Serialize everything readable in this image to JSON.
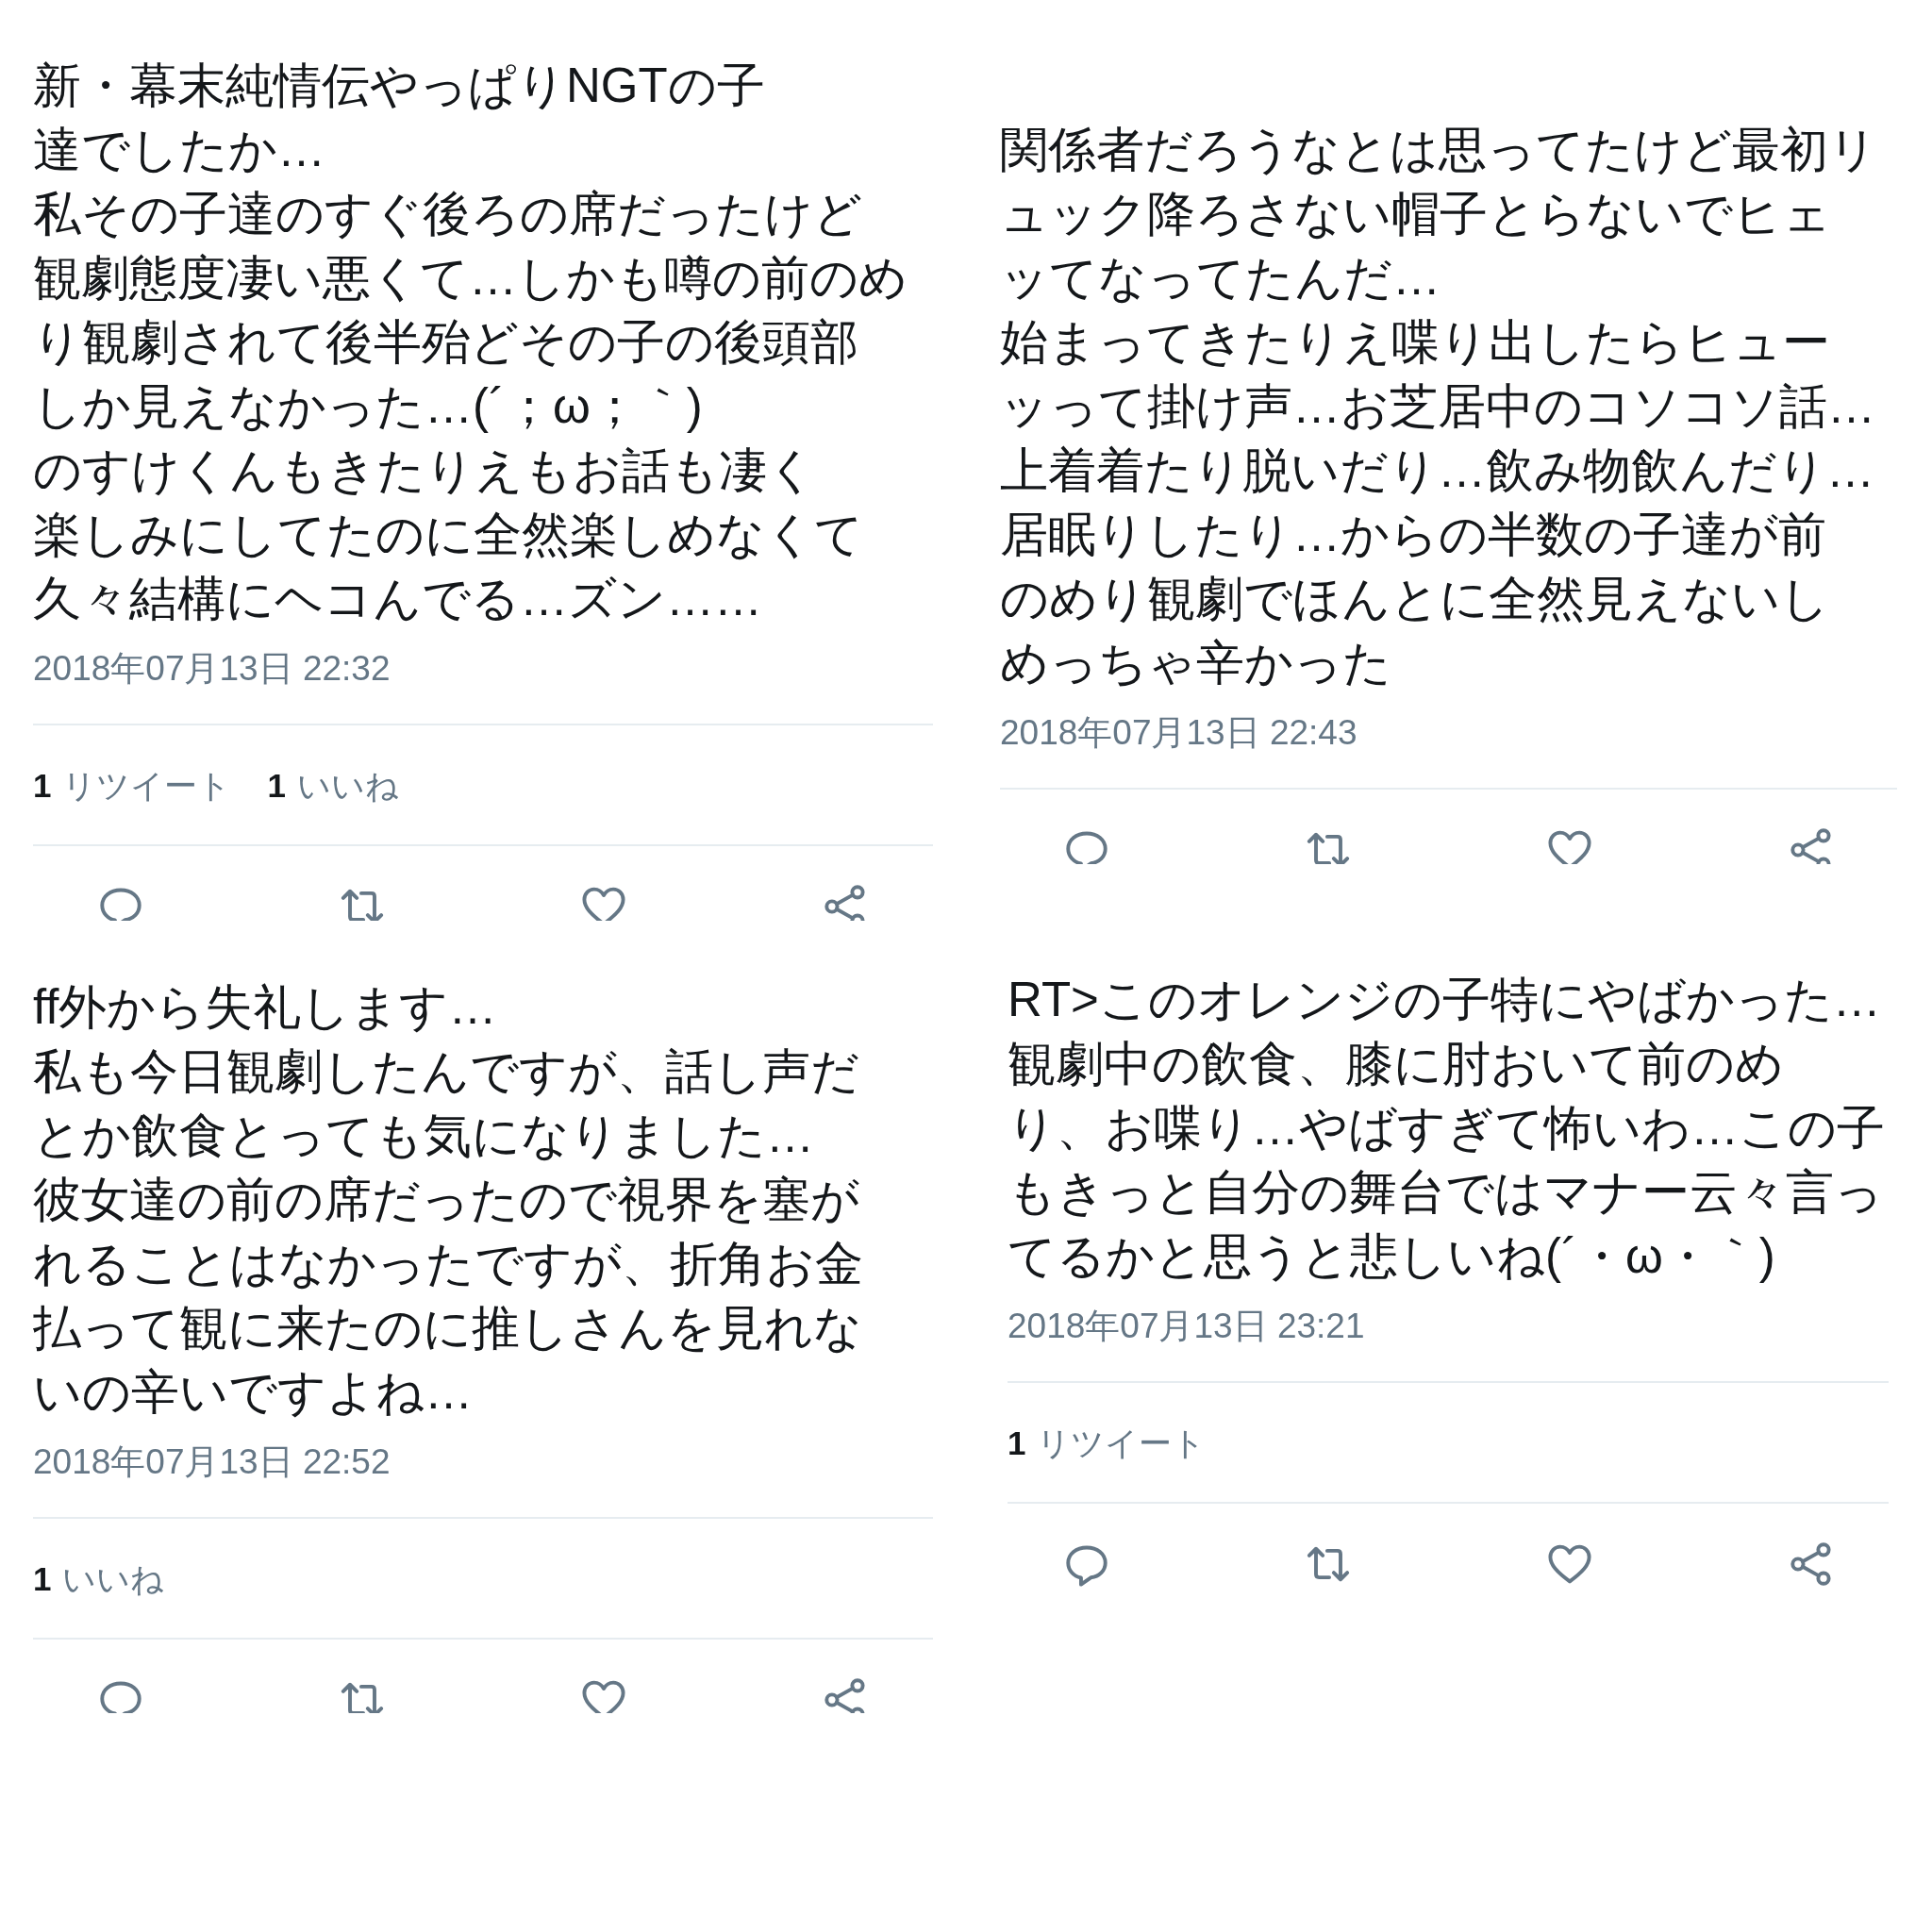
{
  "columns": [
    {
      "tweets": [
        {
          "text_lines": [
            "新・幕末純情伝やっぱりNGTの子",
            "達でしたか…",
            "私その子達のすぐ後ろの席だったけど",
            "観劇態度凄い悪くて…しかも噂の前のめ",
            "り観劇されて後半殆どその子の後頭部",
            "しか見えなかった…(´；ω；｀)",
            "のすけくんもきたりえもお話も凄く",
            "楽しみにしてたのに全然楽しめなくて",
            "久々結構にヘコんでる…ズン……"
          ],
          "timestamp": "2018年07月13日 22:32",
          "stats": [
            {
              "count": "1",
              "label": "リツイート"
            },
            {
              "count": "1",
              "label": "いいね"
            }
          ],
          "actions_cropped": true
        },
        {
          "text_lines": [
            "ff外から失礼します…",
            "私も今日観劇したんですが、話し声だ",
            "とか飲食とっても気になりました…",
            "彼女達の前の席だったので視界を塞が",
            "れることはなかったですが、折角お金",
            "払って観に来たのに推しさんを見れな",
            "いの辛いですよね…"
          ],
          "timestamp": "2018年07月13日 22:52",
          "stats": [
            {
              "count": "1",
              "label": "いいね"
            }
          ],
          "actions_cropped": true
        }
      ]
    },
    {
      "tweets": [
        {
          "text_lines": [
            "関係者だろうなとは思ってたけど最初リ",
            "ュック降ろさない帽子とらないでヒェ",
            "ッてなってたんだ…",
            "始まってきたりえ喋り出したらヒュー",
            "ッって掛け声…お芝居中のコソコソ話…",
            "上着着たり脱いだり…飲み物飲んだり…",
            "居眠りしたり…からの半数の子達が前",
            "のめり観劇でほんとに全然見えないし",
            "めっちゃ辛かった"
          ],
          "timestamp": "2018年07月13日 22:43",
          "actions_cropped": true
        },
        {
          "text_lines": [
            "RT>このオレンジの子特にやばかった…",
            "観劇中の飲食、膝に肘おいて前のめ",
            "り、お喋り…やばすぎて怖いわ…この子",
            "もきっと自分の舞台ではマナー云々言っ",
            "てるかと思うと悲しいね(´・ω・｀)"
          ],
          "timestamp": "2018年07月13日 23:21",
          "stats": [
            {
              "count": "1",
              "label": "リツイート"
            }
          ],
          "actions_cropped": false
        }
      ]
    }
  ]
}
